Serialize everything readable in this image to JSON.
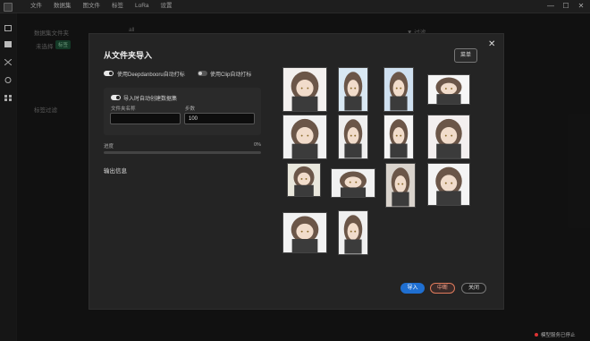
{
  "menubar": {
    "items": [
      "文件",
      "数据集",
      "图文件",
      "标签",
      "LoRa",
      "设置"
    ]
  },
  "window_controls": [
    "—",
    "☐",
    "✕"
  ],
  "background": {
    "dataset_folder_label": "数据集文件夹",
    "dataset_value": "all",
    "unselected_label": "未选择",
    "tag_button": "标签",
    "tag_filter_label": "标签过滤",
    "filter_icon_label": "▼ 过滤"
  },
  "dialog": {
    "title": "从文件夹导入",
    "menu_button": "菜单",
    "close": "✕",
    "toggle_deepdanbooru": {
      "label": "使用Deepdanbooru自动打标",
      "on": true
    },
    "toggle_clip": {
      "label": "使用Clip自动打标",
      "on": false
    },
    "toggle_create_dataset": {
      "label": "导入时自动创建数据集",
      "on": true
    },
    "folder_name_label": "文件夹名称",
    "folder_name_value": "",
    "steps_label": "步数",
    "steps_value": "100",
    "progress_label": "进度",
    "progress_value": "0%",
    "progress_fraction": 0,
    "output_label": "输出信息",
    "buttons": {
      "import": "导入",
      "stop": "中断",
      "close": "关闭"
    }
  },
  "thumbnails_count": 14,
  "status": {
    "text": "模型服务已停止",
    "color": "#d33333"
  }
}
